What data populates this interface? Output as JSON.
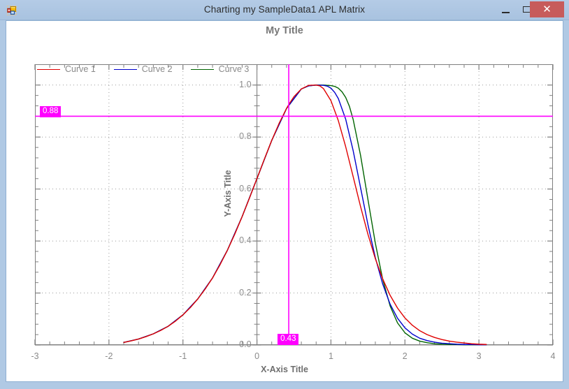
{
  "window": {
    "title": "Charting my SampleData1 APL Matrix",
    "icon": "app-forms-icon",
    "minimize_label": "–",
    "maximize_label": "□",
    "close_label": "✕",
    "border_color": "#a9c3e0",
    "titlebar_color": "#b0c9e4",
    "close_button_color": "#c75b5b"
  },
  "chart_data": {
    "type": "line",
    "title": "My Title",
    "xlabel": "X-Axis Title",
    "ylabel": "Y-Axis Title",
    "xlim": [
      -3,
      4
    ],
    "ylim": [
      0.0,
      1.08
    ],
    "xticks": [
      -3,
      -2,
      -1,
      0,
      1,
      2,
      3,
      4
    ],
    "xtick_labels": [
      "-3",
      "-2",
      "-1",
      "0",
      "1",
      "2",
      "3",
      "4"
    ],
    "yticks": [
      0.0,
      0.2,
      0.4,
      0.6,
      0.8,
      1.0
    ],
    "ytick_labels": [
      "0.0",
      "0.2",
      "0.4",
      "0.6",
      "0.8",
      "1.0"
    ],
    "grid": true,
    "grid_style": "dotted",
    "legend_position": "top-left",
    "series": [
      {
        "name": "Curve 1",
        "color": "#e00000",
        "x": [
          -1.8,
          -1.7,
          -1.6,
          -1.5,
          -1.4,
          -1.3,
          -1.2,
          -1.1,
          -1.0,
          -0.9,
          -0.8,
          -0.7,
          -0.6,
          -0.5,
          -0.4,
          -0.3,
          -0.2,
          -0.1,
          0.0,
          0.1,
          0.2,
          0.3,
          0.4,
          0.43,
          0.5,
          0.6,
          0.7,
          0.8,
          0.85,
          0.9,
          1.0,
          1.1,
          1.2,
          1.3,
          1.4,
          1.5,
          1.6,
          1.7,
          1.8,
          1.9,
          2.0,
          2.1,
          2.2,
          2.3,
          2.4,
          2.5,
          2.6,
          2.7,
          2.8,
          2.9,
          3.0,
          3.1
        ],
        "y": [
          0.01,
          0.016,
          0.023,
          0.032,
          0.043,
          0.056,
          0.072,
          0.092,
          0.116,
          0.144,
          0.177,
          0.215,
          0.258,
          0.308,
          0.364,
          0.426,
          0.494,
          0.566,
          0.64,
          0.715,
          0.787,
          0.853,
          0.91,
          0.925,
          0.955,
          0.985,
          0.999,
          1.0,
          0.997,
          0.986,
          0.94,
          0.863,
          0.762,
          0.648,
          0.533,
          0.426,
          0.332,
          0.254,
          0.191,
          0.142,
          0.104,
          0.076,
          0.055,
          0.04,
          0.029,
          0.021,
          0.015,
          0.011,
          0.008,
          0.005,
          0.003,
          0.002
        ]
      },
      {
        "name": "Curve 2",
        "color": "#0000cd",
        "x": [
          -1.8,
          -1.6,
          -1.4,
          -1.2,
          -1.0,
          -0.8,
          -0.6,
          -0.4,
          -0.2,
          0.0,
          0.2,
          0.4,
          0.6,
          0.7,
          0.8,
          0.9,
          0.95,
          1.0,
          1.05,
          1.1,
          1.2,
          1.3,
          1.4,
          1.5,
          1.6,
          1.7,
          1.8,
          1.9,
          2.0,
          2.1,
          2.2,
          2.3,
          2.4,
          2.5,
          2.6,
          2.7,
          2.8,
          2.9,
          3.0,
          3.1
        ],
        "y": [
          0.01,
          0.023,
          0.043,
          0.072,
          0.116,
          0.177,
          0.258,
          0.364,
          0.494,
          0.64,
          0.787,
          0.91,
          0.985,
          0.997,
          1.0,
          0.999,
          0.996,
          0.988,
          0.972,
          0.948,
          0.868,
          0.748,
          0.606,
          0.463,
          0.336,
          0.234,
          0.157,
          0.103,
          0.066,
          0.042,
          0.026,
          0.017,
          0.011,
          0.007,
          0.005,
          0.003,
          0.002,
          0.002,
          0.001,
          0.001
        ]
      },
      {
        "name": "Curve 3",
        "color": "#006400",
        "x": [
          -1.8,
          -1.6,
          -1.4,
          -1.2,
          -1.0,
          -0.8,
          -0.6,
          -0.4,
          -0.2,
          0.0,
          0.2,
          0.4,
          0.6,
          0.7,
          0.8,
          0.9,
          1.0,
          1.05,
          1.1,
          1.15,
          1.2,
          1.25,
          1.3,
          1.4,
          1.5,
          1.6,
          1.7,
          1.8,
          1.9,
          2.0,
          2.1,
          2.2,
          2.3,
          2.4,
          2.5,
          2.6,
          2.7,
          2.8,
          2.9,
          3.0,
          3.1
        ],
        "y": [
          0.01,
          0.023,
          0.043,
          0.072,
          0.116,
          0.177,
          0.258,
          0.364,
          0.494,
          0.64,
          0.787,
          0.91,
          0.985,
          0.997,
          1.0,
          1.0,
          0.998,
          0.995,
          0.988,
          0.974,
          0.952,
          0.918,
          0.868,
          0.73,
          0.56,
          0.392,
          0.252,
          0.15,
          0.085,
          0.047,
          0.026,
          0.015,
          0.009,
          0.005,
          0.003,
          0.002,
          0.002,
          0.001,
          0.001,
          0.001,
          0.001
        ]
      }
    ],
    "crosshair": {
      "color": "#ff00ff",
      "x_value": 0.43,
      "y_value": 0.88,
      "x_label": "0.43",
      "y_label": "0.88"
    }
  }
}
